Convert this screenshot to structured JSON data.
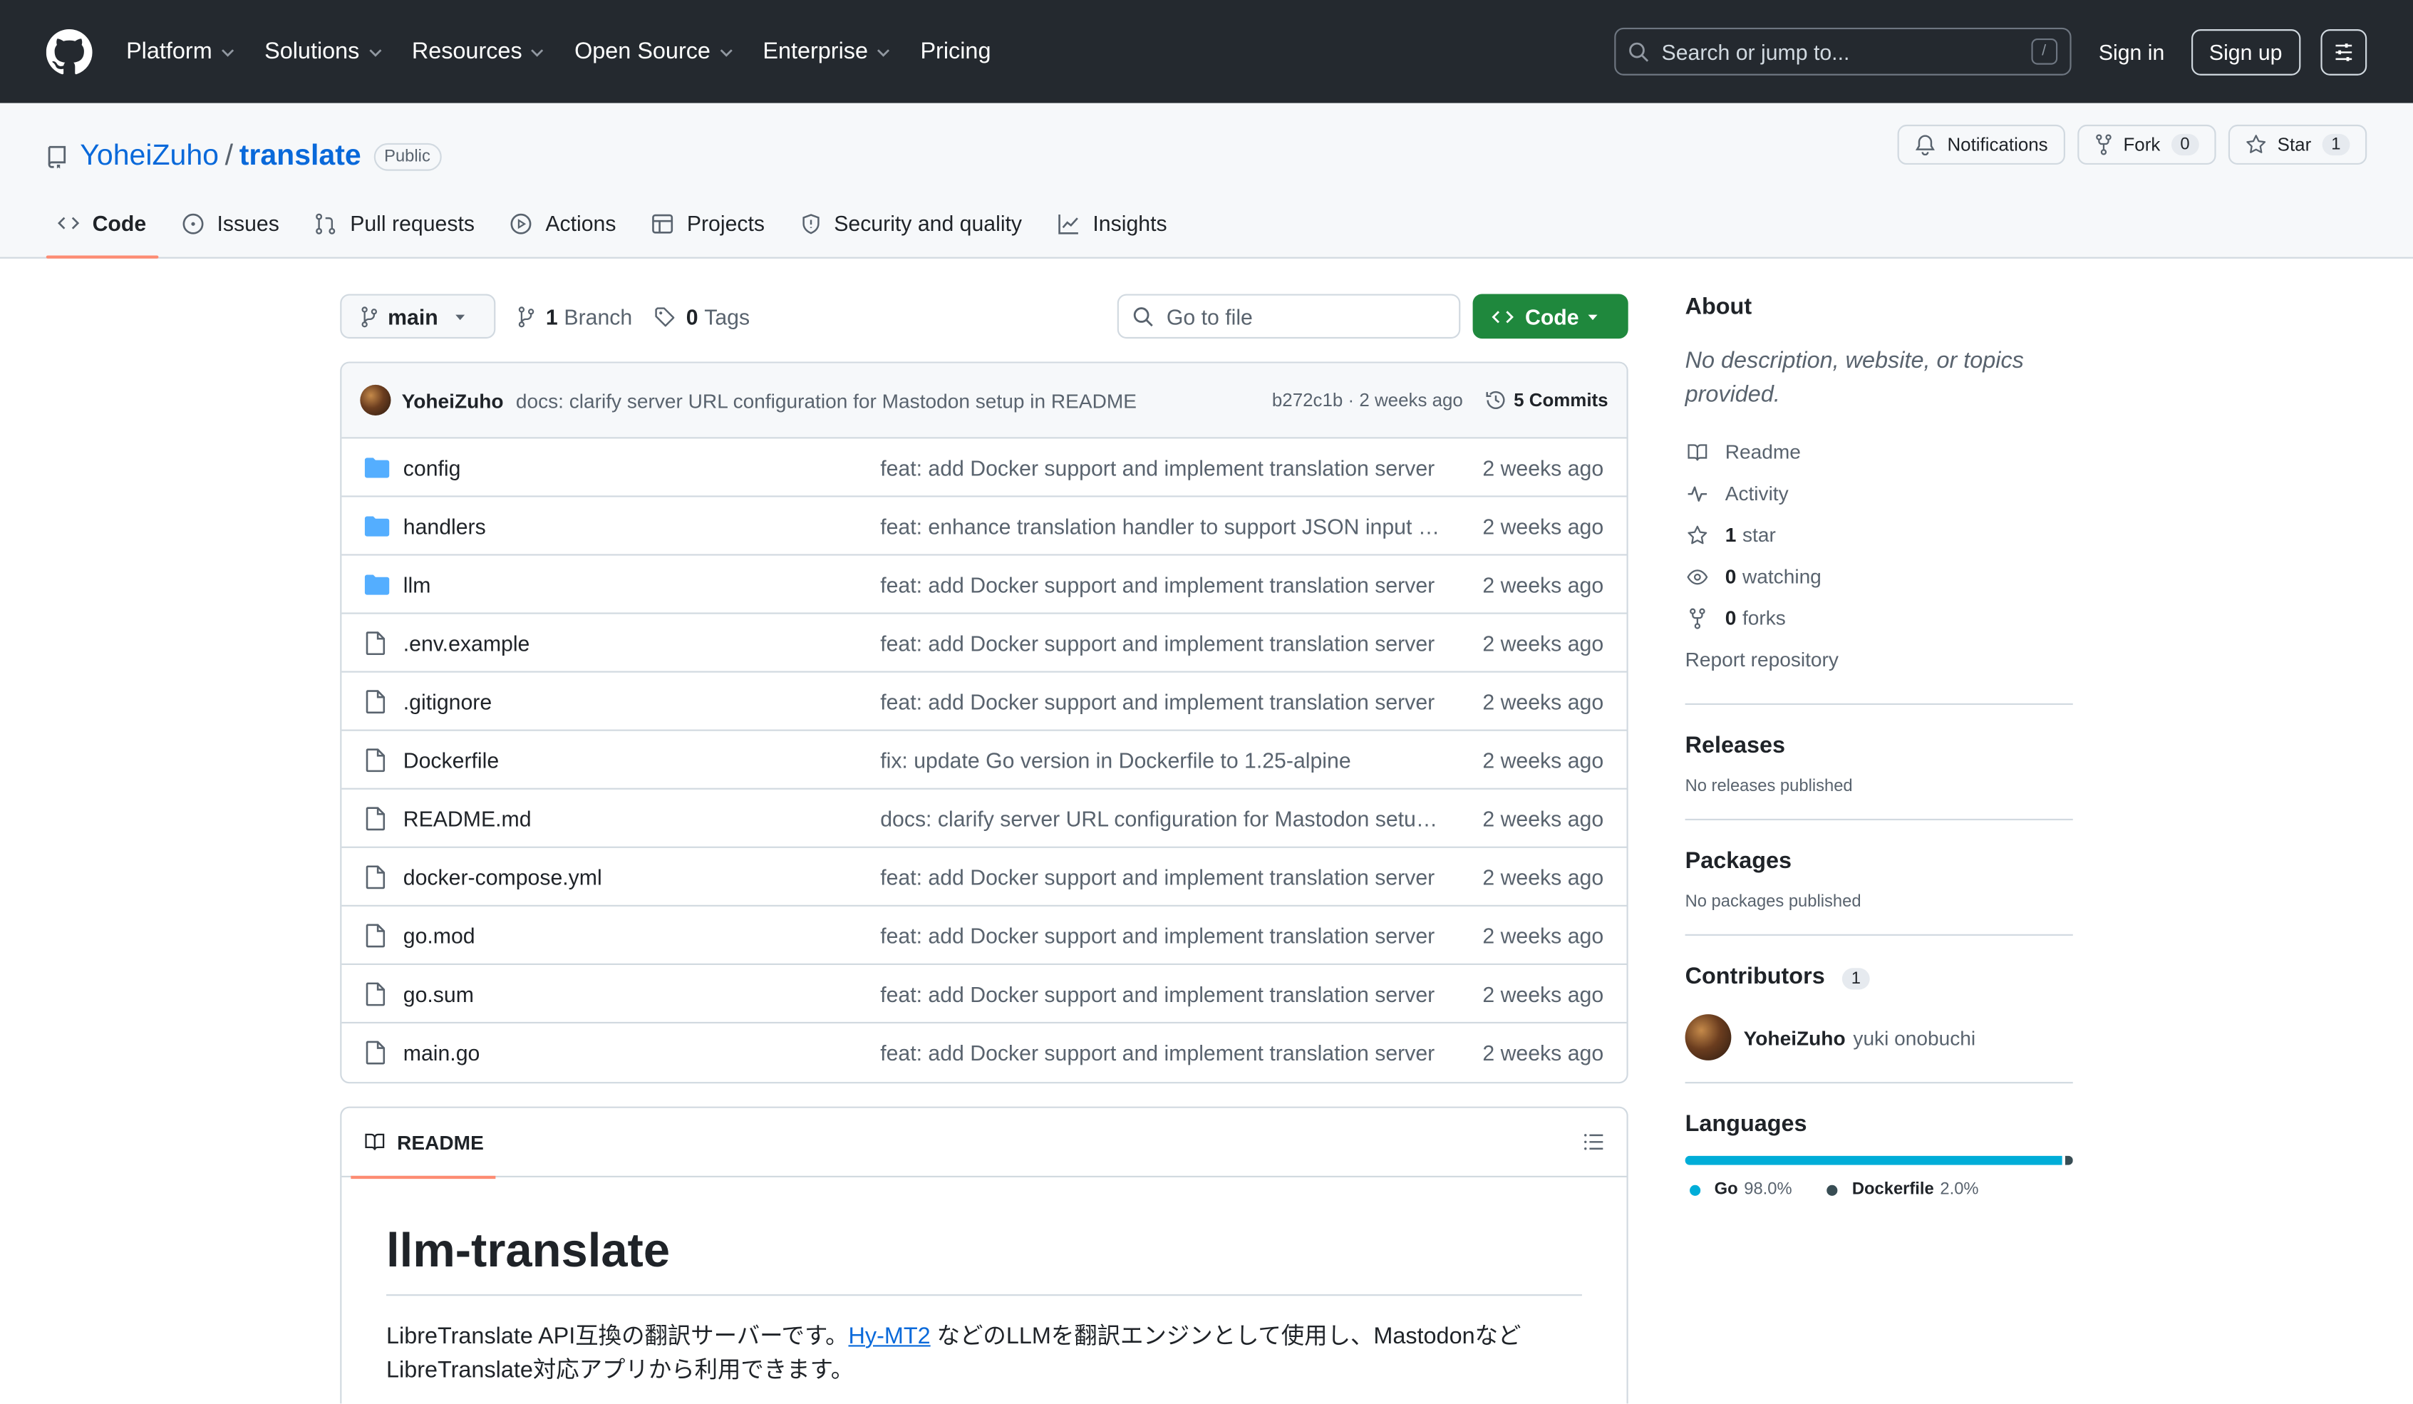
{
  "header": {
    "nav": [
      "Platform",
      "Solutions",
      "Resources",
      "Open Source",
      "Enterprise",
      "Pricing"
    ],
    "search_placeholder": "Search or jump to...",
    "search_shortcut": "/",
    "sign_in": "Sign in",
    "sign_up": "Sign up"
  },
  "repo": {
    "owner": "YoheiZuho",
    "separator": "/",
    "name": "translate",
    "visibility": "Public",
    "notifications": "Notifications",
    "fork_label": "Fork",
    "fork_count": "0",
    "star_label": "Star",
    "star_count": "1"
  },
  "tabs": [
    "Code",
    "Issues",
    "Pull requests",
    "Actions",
    "Projects",
    "Security and quality",
    "Insights"
  ],
  "toolbar": {
    "branch": "main",
    "branches_count": "1",
    "branches_label": "Branch",
    "tags_count": "0",
    "tags_label": "Tags",
    "goto_placeholder": "Go to file",
    "code_label": "Code"
  },
  "commit": {
    "author": "YoheiZuho",
    "message": "docs: clarify server URL configuration for Mastodon setup in README",
    "meta": "b272c1b · 2 weeks ago",
    "commits": "5 Commits"
  },
  "files": [
    {
      "name": "config",
      "type": "dir",
      "message": "feat: add Docker support and implement translation server",
      "date": "2 weeks ago"
    },
    {
      "name": "handlers",
      "type": "dir",
      "message": "feat: enhance translation handler to support JSON input a...",
      "date": "2 weeks ago"
    },
    {
      "name": "llm",
      "type": "dir",
      "message": "feat: add Docker support and implement translation server",
      "date": "2 weeks ago"
    },
    {
      "name": ".env.example",
      "type": "file",
      "message": "feat: add Docker support and implement translation server",
      "date": "2 weeks ago"
    },
    {
      "name": ".gitignore",
      "type": "file",
      "message": "feat: add Docker support and implement translation server",
      "date": "2 weeks ago"
    },
    {
      "name": "Dockerfile",
      "type": "file",
      "message": "fix: update Go version in Dockerfile to 1.25-alpine",
      "date": "2 weeks ago"
    },
    {
      "name": "README.md",
      "type": "file",
      "message": "docs: clarify server URL configuration for Mastodon setup ...",
      "date": "2 weeks ago"
    },
    {
      "name": "docker-compose.yml",
      "type": "file",
      "message": "feat: add Docker support and implement translation server",
      "date": "2 weeks ago"
    },
    {
      "name": "go.mod",
      "type": "file",
      "message": "feat: add Docker support and implement translation server",
      "date": "2 weeks ago"
    },
    {
      "name": "go.sum",
      "type": "file",
      "message": "feat: add Docker support and implement translation server",
      "date": "2 weeks ago"
    },
    {
      "name": "main.go",
      "type": "file",
      "message": "feat: add Docker support and implement translation server",
      "date": "2 weeks ago"
    }
  ],
  "readme": {
    "tab_label": "README",
    "title": "llm-translate",
    "text_before": "LibreTranslate API互換の翻訳サーバーです。",
    "link": "Hy-MT2",
    "text_after": " などのLLMを翻訳エンジンとして使用し、Mastodonなど",
    "line2": "LibreTranslate対応アプリから利用できます。"
  },
  "about": {
    "heading": "About",
    "description": "No description, website, or topics provided.",
    "readme": "Readme",
    "activity": "Activity",
    "stars_count": "1",
    "stars_label": "star",
    "watching_count": "0",
    "watching_label": "watching",
    "forks_count": "0",
    "forks_label": "forks",
    "report": "Report repository"
  },
  "releases": {
    "heading": "Releases",
    "empty": "No releases published"
  },
  "packages": {
    "heading": "Packages",
    "empty": "No packages published"
  },
  "contributors": {
    "heading": "Contributors",
    "count": "1",
    "user": "YoheiZuho",
    "fullname": "yuki onobuchi"
  },
  "languages": {
    "heading": "Languages",
    "items": [
      {
        "name": "Go",
        "percent": "98.0%",
        "value": 98.0,
        "color": "#00ADD8"
      },
      {
        "name": "Dockerfile",
        "percent": "2.0%",
        "value": 2.0,
        "color": "#384d54"
      }
    ]
  },
  "colors": {
    "header_bg": "#24292f",
    "link": "#0969da",
    "primary_button": "#1f883d",
    "active_tab_underline": "#fd8c73"
  }
}
